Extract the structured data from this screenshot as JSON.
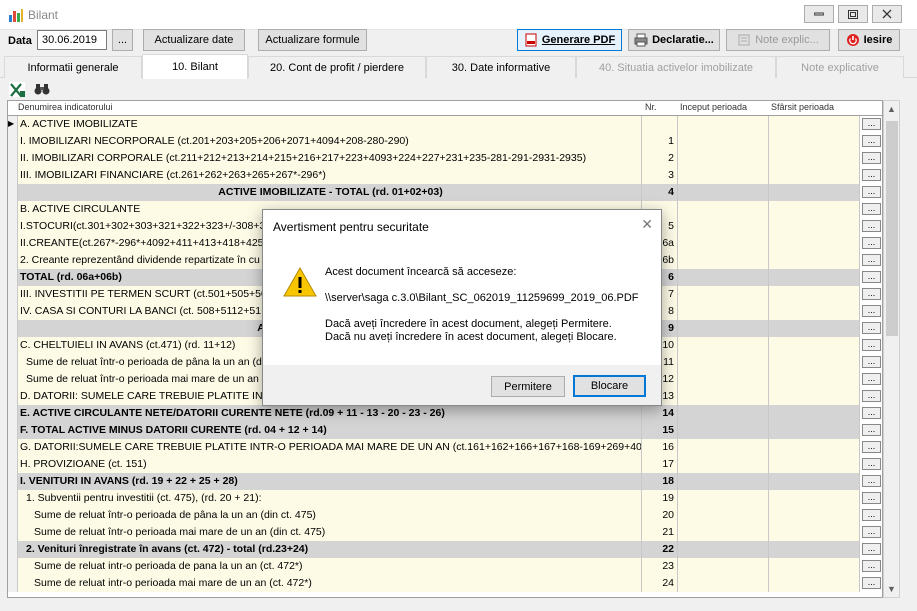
{
  "window": {
    "title": "Bilant"
  },
  "toolbar": {
    "date_label": "Data",
    "date_value": "30.06.2019",
    "date_pick": "...",
    "actualizare_date": "Actualizare date",
    "actualizare_formule": "Actualizare formule",
    "generare_pdf": "Generare PDF",
    "declaratie": "Declaratie...",
    "note_explic": "Note explic...",
    "iesire": "Iesire"
  },
  "tabs": [
    {
      "label": "Informatii generale"
    },
    {
      "label": "10. Bilant"
    },
    {
      "label": "20. Cont de profit / pierdere"
    },
    {
      "label": "30. Date informative"
    },
    {
      "label": "40. Situatia activelor imobilizate"
    },
    {
      "label": "Note explicative"
    }
  ],
  "grid": {
    "headers": {
      "name": "Denumirea indicatorului",
      "nr": "Nr.",
      "inceput": "Inceput perioada",
      "sfarsit": "Sfârsit perioada"
    },
    "current_marker": "▶",
    "rows": [
      {
        "name": "A. ACTIVE IMOBILIZATE",
        "nr": ""
      },
      {
        "name": "I. IMOBILIZARI NECORPORALE (ct.201+203+205+206+2071+4094+208-280-290)",
        "nr": "1"
      },
      {
        "name": "II. IMOBILIZARI CORPORALE (ct.211+212+213+214+215+216+217+223+4093+224+227+231+235-281-291-2931-2935)",
        "nr": "2"
      },
      {
        "name": "III. IMOBILIZARI FINANCIARE (ct.261+262+263+265+267*-296*)",
        "nr": "3"
      },
      {
        "name": "ACTIVE IMOBILIZATE - TOTAL (rd. 01+02+03)",
        "nr": "4"
      },
      {
        "name": "B. ACTIVE CIRCULANTE",
        "nr": ""
      },
      {
        "name": "I.STOCURI(ct.301+302+303+321+322+323+/-308+3",
        "nr": "5"
      },
      {
        "name": "II.CREANTE(ct.267*-296*+4092+411+413+418+425",
        "nr": "6a"
      },
      {
        "name": "2. Creante reprezentând dividende repartizate în cu",
        "nr": "6b"
      },
      {
        "name": "TOTAL (rd. 06a+06b)",
        "nr": "6"
      },
      {
        "name": "III. INVESTITII PE TERMEN SCURT (ct.501+505+506+",
        "nr": "7"
      },
      {
        "name": "IV. CASA SI CONTURI LA BANCI (ct. 508+5112+51",
        "nr": "8"
      },
      {
        "name": "ACTIVE CIRCULANTE - TOTA",
        "nr": "9"
      },
      {
        "name": "C. CHELTUIELI IN AVANS (ct.471) (rd. 11+12)",
        "nr": "10"
      },
      {
        "name": "Sume de reluat într-o perioada de pâna la un an (d",
        "nr": "11"
      },
      {
        "name": "Sume de reluat într-o perioada mai mare de un an",
        "nr": "12"
      },
      {
        "name": "D. DATORII: SUMELE CARE TREBUIE PLATITE INTR-",
        "nr": "13"
      },
      {
        "name": "E. ACTIVE CIRCULANTE NETE/DATORII CURENTE NETE (rd.09 + 11 - 13 - 20 - 23 - 26)",
        "nr": "14"
      },
      {
        "name": "F. TOTAL ACTIVE MINUS DATORII CURENTE (rd. 04 + 12 + 14)",
        "nr": "15"
      },
      {
        "name": "G. DATORII:SUMELE CARE TREBUIE PLATITE INTR-O PERIOADA MAI MARE DE UN AN (ct.161+162+166+167+168-169+269+401+4",
        "nr": "16"
      },
      {
        "name": "H. PROVIZIOANE (ct. 151)",
        "nr": "17"
      },
      {
        "name": "I. VENITURI IN AVANS (rd. 19 + 22 + 25 + 28)",
        "nr": "18"
      },
      {
        "name": "1. Subventii pentru investitii (ct. 475), (rd. 20 + 21):",
        "nr": "19"
      },
      {
        "name": "Sume de reluat într-o perioada de pâna la un an (din ct. 475)",
        "nr": "20"
      },
      {
        "name": "Sume de reluat într-o perioada mai mare de un an (din ct. 475)",
        "nr": "21"
      },
      {
        "name": "2. Venituri înregistrate în avans (ct. 472) - total (rd.23+24)",
        "nr": "22"
      },
      {
        "name": "Sume de reluat intr-o perioada de pana la un an (ct. 472*)",
        "nr": "23"
      },
      {
        "name": "Sume de reluat intr-o perioada mai mare de un an (ct. 472*)",
        "nr": "24"
      }
    ],
    "row_button": "..."
  },
  "dialog": {
    "title": "Avertisment pentru securitate",
    "line1": "Acest document încearcă să acceseze:",
    "line2": "\\\\server\\saga c.3.0\\Bilant_SC_062019_11259699_2019_06.PDF",
    "line3": "Dacă aveți încredere în acest document, alegeți Permitere.",
    "line4": "Dacă nu aveți încredere în acest document, alegeți Blocare.",
    "permit": "Permitere",
    "block": "Blocare"
  },
  "colors": {
    "accent": "#0078d7",
    "row_bg": "#fdfbe6",
    "total_bg": "#d4d4d4"
  }
}
